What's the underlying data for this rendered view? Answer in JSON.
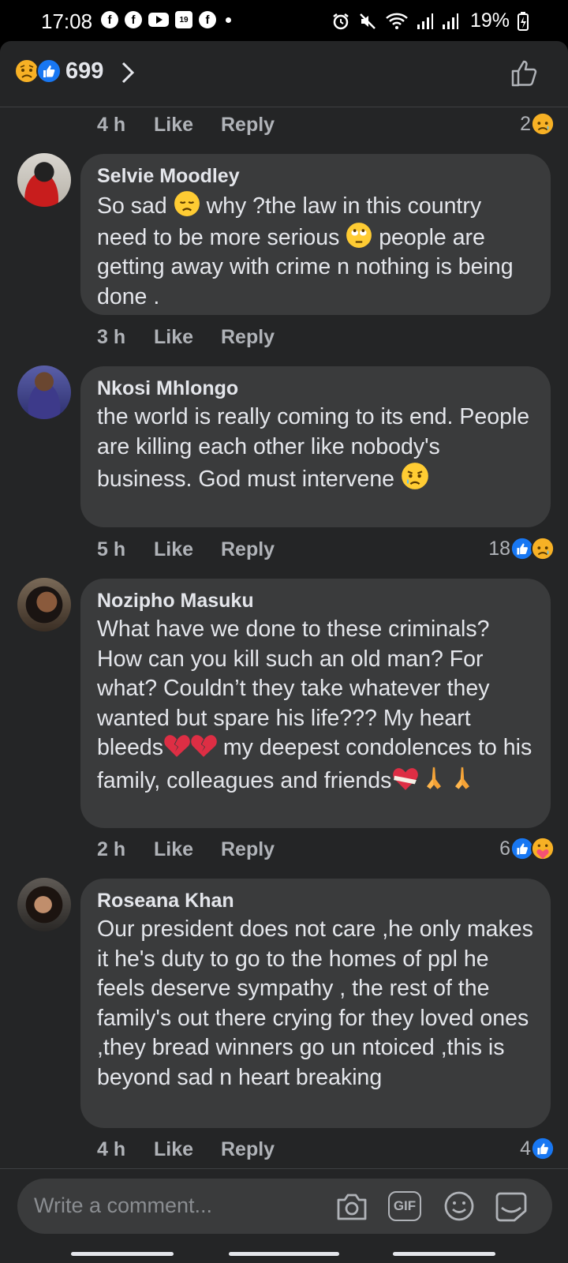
{
  "status_bar": {
    "time": "17:08",
    "calendar_day": "19",
    "battery": "19%"
  },
  "header": {
    "reaction_count": "699",
    "reactions": [
      "sad-icon",
      "like-icon"
    ]
  },
  "comments": [
    {
      "time": "4 h",
      "like_label": "Like",
      "reply_label": "Reply",
      "reaction_count": "2"
    },
    {
      "author": "Selvie Moodley",
      "time": "3 h",
      "like_label": "Like",
      "reply_label": "Reply",
      "text_parts": [
        "So sad ",
        " why ?the law in this country need to be more serious ",
        " people are getting away with crime n nothing is being done ."
      ]
    },
    {
      "author": "Nkosi Mhlongo",
      "time": "5 h",
      "like_label": "Like",
      "reply_label": "Reply",
      "reaction_count": "18",
      "text_parts": [
        "the world is really coming to its end. People are killing each other like nobody's business. God must intervene "
      ]
    },
    {
      "author": "Nozipho Masuku",
      "time": "2 h",
      "like_label": "Like",
      "reply_label": "Reply",
      "reaction_count": "6",
      "text_parts": [
        "What have we done to these criminals? How can you kill such an old man? For what? Couldn’t they take whatever they wanted but spare his life??? My heart bleeds",
        " my deepest condolences to his family, colleagues and friends"
      ]
    },
    {
      "author": "Roseana Khan",
      "time": "4 h",
      "like_label": "Like",
      "reply_label": "Reply",
      "reaction_count": "4",
      "text_parts": [
        "Our president does not care ,he only makes it he's duty to go to the homes of ppl he feels deserve sympathy , the rest of the family's out there crying for they loved ones ,they bread winners go un ntoiced ,this is beyond sad n heart breaking"
      ]
    }
  ],
  "composer": {
    "placeholder": "Write a comment...",
    "gif_label": "GIF"
  },
  "colors": {
    "background": "#242526",
    "bubble": "#3a3b3c",
    "like_blue": "#1877f2",
    "sad_yellow": "#f7b125",
    "text": "#e4e6eb",
    "muted": "#b0b3b8"
  }
}
